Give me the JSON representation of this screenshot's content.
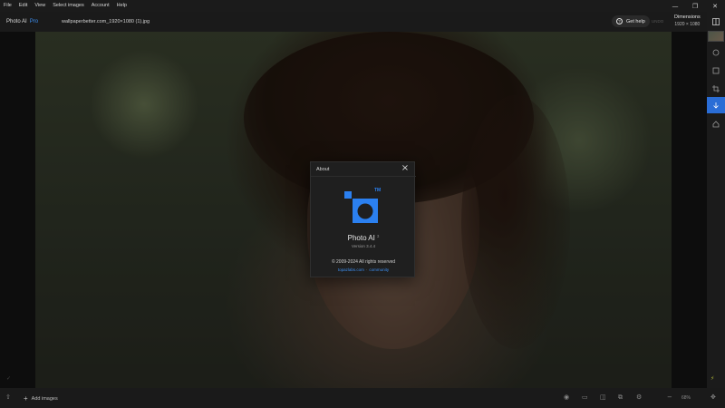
{
  "menubar": {
    "items": [
      "File",
      "Edit",
      "View",
      "Select images",
      "Account",
      "Help"
    ]
  },
  "window_controls": {
    "minimize": "—",
    "restore": "❐",
    "close": "✕"
  },
  "header": {
    "app_name": "Photo AI",
    "app_tier": "Pro",
    "file_name": "wallpaperbetter.com_1920×1080 (1).jpg",
    "help_label": "Get help",
    "undo_label": "UNDO",
    "dimensions_title": "Dimensions",
    "dimensions_value": "1920 × 1080"
  },
  "sidebar": {
    "icons": [
      "compare-icon",
      "layers-icon",
      "adjust-icon",
      "crop-icon",
      "down-arrow-icon",
      "home-icon"
    ],
    "active_index": 4,
    "accent": "#2a6dd6"
  },
  "dialog": {
    "title": "About",
    "app_name": "Photo AI",
    "app_name_sup": "3",
    "version": "Version 3.4.4",
    "copyright": "© 2009-2024 All rights reserved",
    "link_website": "topazlabs.com",
    "link_separator": "·",
    "link_community": "community",
    "logo_tm": "TM",
    "logo_color": "#2b80f0"
  },
  "bottombar": {
    "add_images_label": "Add images",
    "zoom_label": "68%"
  },
  "colors": {
    "accent": "#3d8ef0",
    "background": "#141414"
  }
}
